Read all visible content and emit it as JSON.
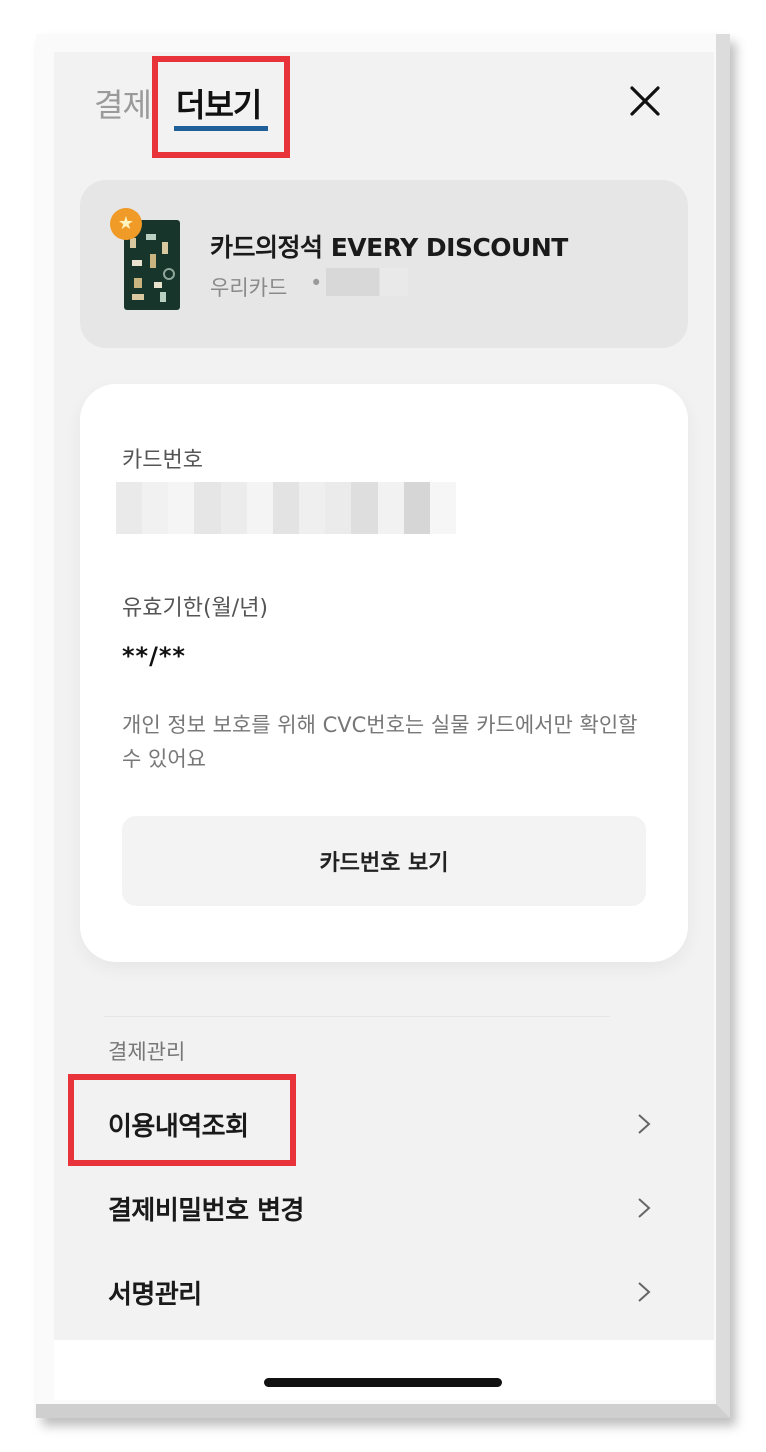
{
  "header": {
    "tabs": [
      {
        "label": "결제",
        "active": false
      },
      {
        "label": "더보기",
        "active": true
      }
    ],
    "close_icon": "close-icon"
  },
  "card": {
    "name": "카드의정석 EVERY DISCOUNT",
    "issuer": "우리카드",
    "separator": "•",
    "badge_icon": "star-icon"
  },
  "details": {
    "card_number_label": "카드번호",
    "expiry_label": "유효기한(월/년)",
    "expiry_value": "**/**",
    "notice": "개인 정보 보호를 위해 CVC번호는 실물 카드에서만 확인할 수 있어요",
    "reveal_button": "카드번호 보기"
  },
  "payment_management": {
    "title": "결제관리",
    "items": [
      {
        "label": "이용내역조회"
      },
      {
        "label": "결제비밀번호 변경"
      },
      {
        "label": "서명관리"
      }
    ]
  },
  "colors": {
    "highlight": "#e8333a",
    "tab_underline": "#1f5f9a",
    "card_background": "#17352b",
    "badge": "#f09a28"
  }
}
